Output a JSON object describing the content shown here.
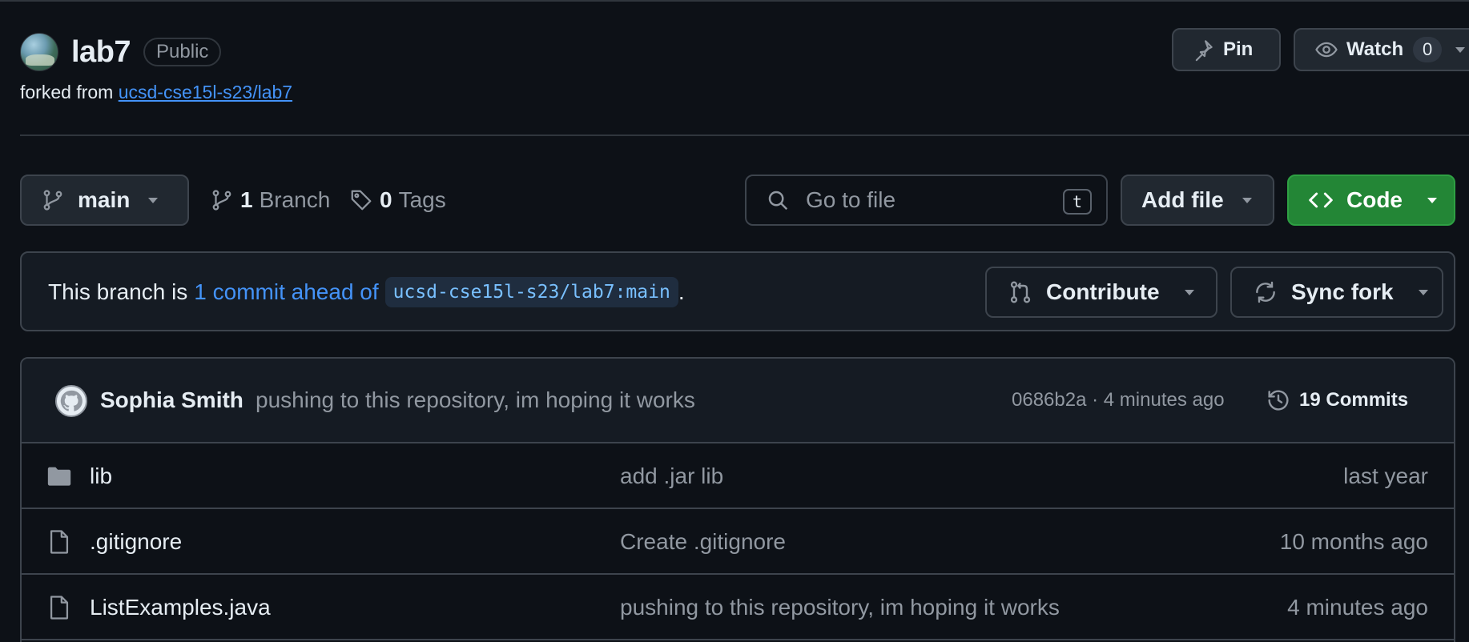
{
  "repo": {
    "name": "lab7",
    "visibility": "Public",
    "forked_prefix": "forked from",
    "forked_from": "ucsd-cse15l-s23/lab7"
  },
  "header_actions": {
    "pin_label": "Pin",
    "watch_label": "Watch",
    "watch_count": "0"
  },
  "toolbar": {
    "branch_name": "main",
    "branch_count": "1",
    "branch_label": "Branch",
    "tag_count": "0",
    "tag_label": "Tags",
    "search_placeholder": "Go to file",
    "search_shortcut": "t",
    "add_file_label": "Add file",
    "code_label": "Code"
  },
  "branch_status": {
    "prefix": "This branch is",
    "ahead_text": "1 commit ahead of",
    "base_ref": "ucsd-cse15l-s23/lab7:main",
    "suffix": ".",
    "contribute_label": "Contribute",
    "sync_label": "Sync fork"
  },
  "latest_commit": {
    "author": "Sophia Smith",
    "message": "pushing to this repository, im hoping it works",
    "sha": "0686b2a",
    "separator": "·",
    "time": "4 minutes ago",
    "commits_label": "19 Commits"
  },
  "files": [
    {
      "name": "lib",
      "type": "folder",
      "message": "add .jar lib",
      "age": "last year"
    },
    {
      "name": ".gitignore",
      "type": "file",
      "message": "Create .gitignore",
      "age": "10 months ago"
    },
    {
      "name": "ListExamples.java",
      "type": "file",
      "message": "pushing to this repository, im hoping it works",
      "age": "4 minutes ago"
    }
  ],
  "icons": {
    "pin": "pin-icon",
    "watch": "eye-icon",
    "branch": "git-branch-icon",
    "tag": "tag-icon",
    "search": "search-icon",
    "code": "code-icon",
    "contribute": "git-pull-request-icon",
    "sync": "sync-icon",
    "history": "history-icon",
    "folder": "folder-icon",
    "file": "file-icon"
  },
  "colors": {
    "background": "#0d1117",
    "accent_link": "#4493f8",
    "code_button": "#238636"
  }
}
